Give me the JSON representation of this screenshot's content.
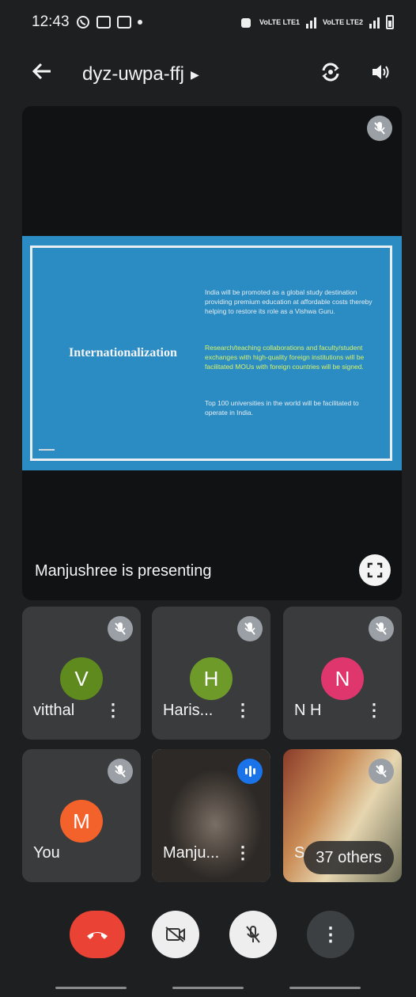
{
  "status_bar": {
    "time": "12:43",
    "network_1": "VoLTE LTE1",
    "network_2": "VoLTE LTE2"
  },
  "top_bar": {
    "meeting_code": "dyz-uwpa-ffj"
  },
  "presentation": {
    "slide_title": "Internationalization",
    "slide_paragraphs": [
      "India will be promoted as a global study destination providing premium education at affordable costs thereby helping to restore its role as a Vishwa Guru.",
      "Research/teaching collaborations and faculty/student exchanges with high-quality foreign institutions will be facilitated MOUs with foreign countries will be signed.",
      "Top 100 universities in the world will be facilitated to operate in India."
    ],
    "presenting_label": "Manjushree is presenting"
  },
  "participants": [
    {
      "name": "vitthal",
      "initial": "V",
      "color": "#5f8a1e"
    },
    {
      "name": "Haris...",
      "initial": "H",
      "color": "#6e9a2a"
    },
    {
      "name": "N H",
      "initial": "N",
      "color": "#e0366e"
    },
    {
      "name": "You",
      "initial": "M",
      "color": "#f4622b"
    },
    {
      "name": "Manju...",
      "initial": "",
      "color": ""
    },
    {
      "name": "S",
      "initial": "",
      "color": ""
    }
  ],
  "others_label": "37 others",
  "icons": [
    "back-arrow-icon",
    "caret-right-icon",
    "switch-camera-icon",
    "speaker-icon",
    "mic-off-icon",
    "fullscreen-icon",
    "more-vert-icon",
    "speaking-indicator-icon",
    "end-call-icon",
    "camera-off-icon"
  ]
}
